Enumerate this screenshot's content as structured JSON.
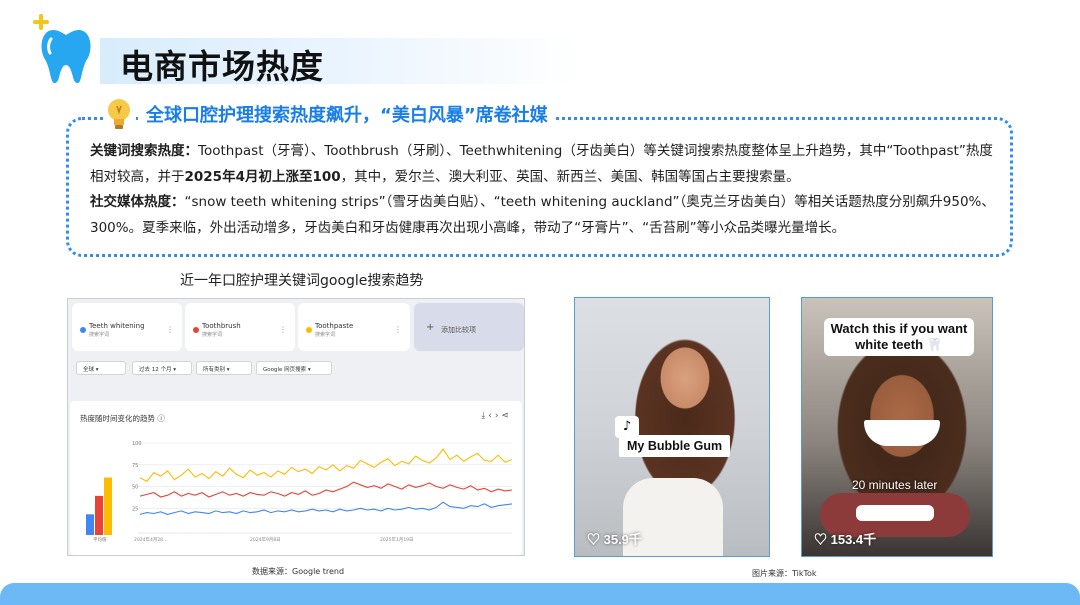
{
  "header": {
    "title": "电商市场热度"
  },
  "highlight": {
    "title": "全球口腔护理搜索热度飙升，“美白风暴”席卷社媒",
    "p1_label": "关键词搜索热度：",
    "p1_text_a": "Toothpast（牙膏）、Toothbrush（牙刷）、Teethwhitening（牙齿美白）等关键词搜索热度整体呈上升趋势，其中“Toothpast”热度相对较高，并于",
    "p1_bold": "2025年4月初上涨至100",
    "p1_text_b": "，其中，爱尔兰、澳大利亚、英国、新西兰、美国、韩国等国占主要搜索量。",
    "p2_label": "社交媒体热度：",
    "p2_text": "“snow teeth whitening strips”（雪牙齿美白贴）、“teeth whitening auckland”（奥克兰牙齿美白）等相关话题热度分别飙升950%、300%。夏季来临，外出活动增多，牙齿美白和牙齿健康再次出现小高峰，带动了“牙膏片”、“舌苔刷”等小众品类曝光量增长。"
  },
  "trends": {
    "caption": "近一年口腔护理关键词google搜索趋势",
    "terms": [
      {
        "label": "Teeth whitening",
        "sub": "搜索字词",
        "color": "#4285f4"
      },
      {
        "label": "Toothbrush",
        "sub": "搜索字词",
        "color": "#ea4335"
      },
      {
        "label": "Toothpaste",
        "sub": "搜索字词",
        "color": "#fbbc04"
      }
    ],
    "add_label": "添加比较项",
    "filters": [
      "全球 ▾",
      "过去 12 个月 ▾",
      "所有类别 ▾",
      "Google 网页搜索 ▾"
    ],
    "chart_title": "热度随时间变化的趋势",
    "source": "数据来源：Google trend"
  },
  "chart_data": {
    "type": "line",
    "y_ticks": [
      "100",
      "75",
      "50",
      "25"
    ],
    "x_ticks": [
      "2024年4月28...",
      "2024年9月8日",
      "2025年1月19日"
    ],
    "ylim": [
      0,
      100
    ],
    "average_label": "平均值",
    "average_bars": [
      {
        "name": "Teeth whitening",
        "value": 18,
        "color": "#4285f4"
      },
      {
        "name": "Toothbrush",
        "value": 34,
        "color": "#ea4335"
      },
      {
        "name": "Toothpaste",
        "value": 50,
        "color": "#fbbc04"
      }
    ],
    "series": [
      {
        "name": "Toothpaste",
        "color": "#fbbc04",
        "values": [
          60,
          56,
          66,
          62,
          68,
          58,
          63,
          70,
          61,
          65,
          59,
          67,
          62,
          71,
          64,
          60,
          69,
          63,
          66,
          61,
          68,
          64,
          72,
          67,
          70,
          65,
          73,
          69,
          75,
          68,
          74,
          71,
          80,
          76,
          72,
          78,
          82,
          74,
          79,
          76,
          85,
          80,
          77,
          83,
          93,
          81,
          86,
          79,
          84,
          88,
          80,
          79,
          86,
          78,
          81
        ]
      },
      {
        "name": "Toothbrush",
        "color": "#ea4335",
        "values": [
          39,
          41,
          43,
          38,
          40,
          44,
          39,
          42,
          40,
          43,
          38,
          41,
          44,
          40,
          42,
          39,
          43,
          41,
          40,
          44,
          42,
          39,
          43,
          41,
          45,
          40,
          42,
          46,
          44,
          47,
          50,
          55,
          52,
          49,
          51,
          48,
          53,
          50,
          47,
          52,
          49,
          51,
          54,
          50,
          48,
          52,
          49,
          47,
          51,
          46,
          48,
          44,
          47,
          45,
          46
        ]
      },
      {
        "name": "Teeth whitening",
        "color": "#4285f4",
        "values": [
          18,
          20,
          19,
          21,
          18,
          20,
          22,
          19,
          21,
          20,
          19,
          22,
          20,
          21,
          19,
          22,
          20,
          21,
          23,
          20,
          22,
          21,
          23,
          21,
          22,
          24,
          22,
          23,
          21,
          24,
          22,
          23,
          25,
          23,
          24,
          22,
          25,
          23,
          24,
          26,
          24,
          25,
          23,
          26,
          32,
          27,
          26,
          25,
          28,
          27,
          30,
          26,
          28,
          29,
          30
        ]
      }
    ]
  },
  "photos": {
    "card1_label": "My Bubble Gum",
    "card1_logo": "♪",
    "card1_likes": "♡ 35.9千",
    "card2_label": "Watch this if you want white teeth 🦷",
    "card2_overlay": "20 minutes later",
    "card2_likes": "♡ 153.4千",
    "source": "图片来源：TikTok"
  }
}
